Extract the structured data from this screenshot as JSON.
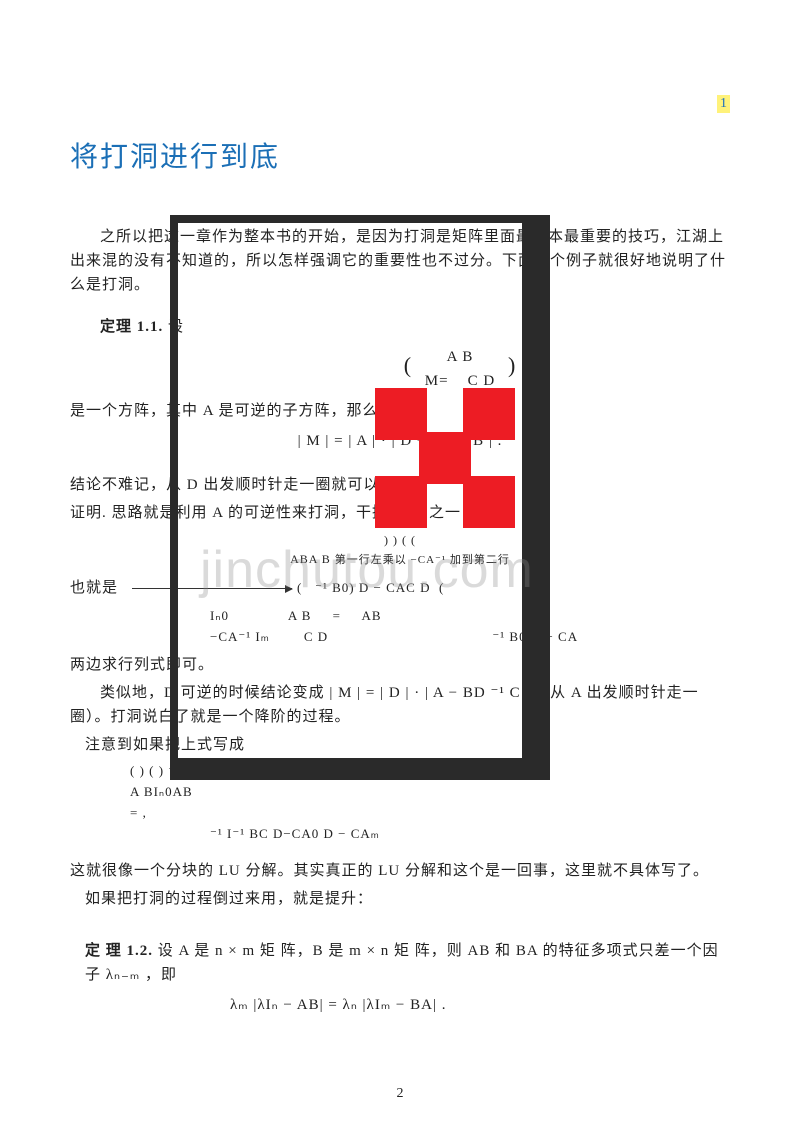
{
  "page": {
    "top_page_number": "1",
    "bottom_page_number": "2",
    "title": "将打洞进行到底",
    "watermark": "jinchutou.com",
    "intro": "之所以把这一章作为整本书的开始，是因为打洞是矩阵里面最基本最重要的技巧，江湖上出来混的没有不知道的，所以怎样强调它的重要性也不过分。下面这个例子就很好地说明了什么是打洞。",
    "theorem1": {
      "label": "定理 1.1.",
      "lead": "设",
      "matrix_top": "A B",
      "matrix_bottom": "C D",
      "matrix_lhs": "M=",
      "cond": "是一个方阵，其中 A 是可逆的子方阵，那么",
      "result": "| M | = | A | · | D − CA⁻¹ B | ."
    },
    "line_memo": "结论不难记，从 D 出发顺时针走一圈就可以了。",
    "proof_lead": "证明. 思路就是利用 A 的可逆性来打洞，干掉 B, C 之一：",
    "proof_step_note": "第一行左乘以 −CA⁻¹ 加到第二行",
    "proof_frag1": "ABA B",
    "also_line": "也就是",
    "block2_a": "Iₙ0",
    "block2_b": "−CA⁻¹ Iₘ",
    "block2_c": "A B",
    "block2_d": "C D",
    "block2_e": "AB",
    "block2_f": "⁻¹ B0) D  −  CAC D",
    "block2_g": "⁻¹ B0 D − CA",
    "det_line": "两边求行列式即可。",
    "similar": "类似地，D 可逆的时候结论变成 | M | = | D | · | A − BD ⁻¹ C | （从 A 出发顺时针走一圈）。打洞说白了就是一个降阶的过程。",
    "note_line": "注意到如果把上式写成",
    "frag_a": "( ) ( ) ⁻¹ ( )",
    "frag_b": "A BIₙ0AB",
    "frag_c": "= ,",
    "frag_d": "⁻¹ I⁻¹ BC D−CA0 D − CAₘ",
    "lu_para": "这就很像一个分块的 LU 分解。其实真正的 LU 分解和这个是一回事，这里就不具体写了。",
    "reverse_line": "如果把打洞的过程倒过来用，就是提升：",
    "theorem2": {
      "label": "定 理 1.2.",
      "body": "设 A 是 n × m 矩 阵，B 是 m × n 矩 阵，则 AB 和 BA 的特征多项式只差一个因子 λₙ₋ₘ ，即",
      "formula": "λₘ |λIₙ − AB| = λₙ |λIₘ − BA| ."
    }
  }
}
